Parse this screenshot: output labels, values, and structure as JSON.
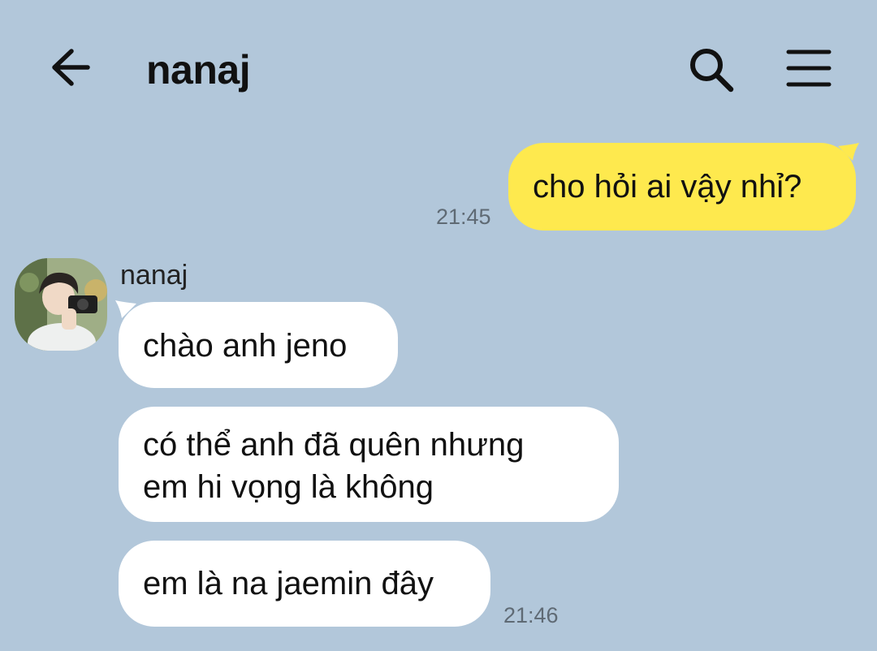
{
  "header": {
    "title": "nanaj",
    "back_icon": "arrow-left-icon",
    "search_icon": "search-icon",
    "menu_icon": "hamburger-menu-icon"
  },
  "colors": {
    "background": "#b2c7da",
    "outgoing_bubble": "#fee94e",
    "incoming_bubble": "#ffffff",
    "timestamp": "#5f6a74"
  },
  "messages": {
    "outgoing": [
      {
        "text": "cho hỏi ai vậy nhỉ?",
        "time": "21:45"
      }
    ],
    "incoming_group": {
      "sender": "nanaj",
      "avatar_icon": "profile-photo-avatar",
      "bubbles": [
        {
          "lines": [
            "chào anh jeno"
          ]
        },
        {
          "lines": [
            "có thể anh đã quên nhưng",
            "em hi vọng là không"
          ]
        },
        {
          "lines": [
            "em là na jaemin đây"
          ]
        }
      ],
      "time": "21:46"
    }
  }
}
